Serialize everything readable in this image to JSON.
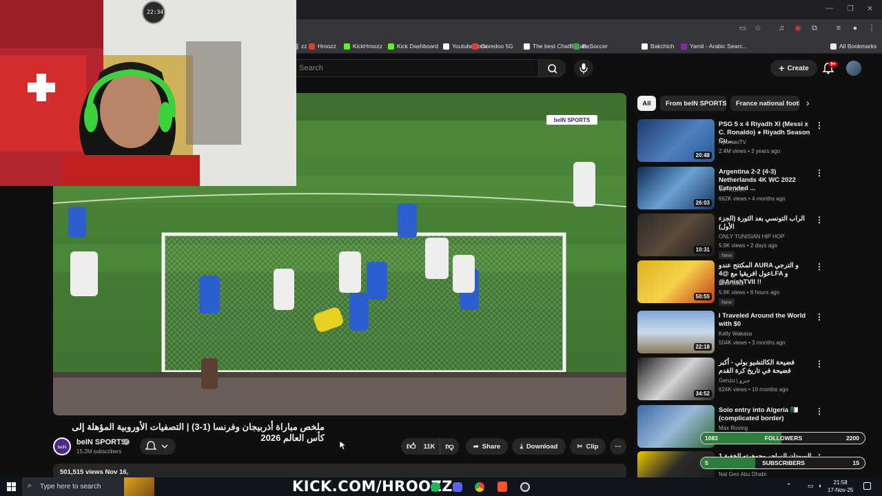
{
  "browser": {
    "bookmarks": [
      {
        "label": "zz",
        "color": "#888"
      },
      {
        "label": "Hroozz",
        "color": "#e53935"
      },
      {
        "label": "KickHroozz",
        "color": "#53fc18"
      },
      {
        "label": "Kick Dashboard",
        "color": "#53fc18"
      },
      {
        "label": "Youtube conv",
        "color": "#ffffff"
      },
      {
        "label": "Ooredoo 5G",
        "color": "#e53935"
      },
      {
        "label": "The best ChatBot an...",
        "color": "#ffffff"
      },
      {
        "label": "BeSoccer",
        "color": "#43a047"
      },
      {
        "label": "Bakchich",
        "color": "#ffffff"
      },
      {
        "label": "Yamli - Arabic Searc...",
        "color": "#8e24aa"
      },
      {
        "label": "All Bookmarks",
        "color": "#e8eaed"
      }
    ]
  },
  "header": {
    "search_placeholder": "Search",
    "create_label": "Create",
    "notifications": "9+"
  },
  "webcam": {
    "clock_text": "22:34"
  },
  "video": {
    "watermark": "beIN SPORTS",
    "title": "ملخص مباراة أذربيجان وفرنسا (1-3) | التصفيات الأوروبية المؤهلة إلى كأس العالم 2026",
    "channel": "beIN SPORTS",
    "subscribers": "15.2M subscribers",
    "likes": "11K",
    "share_label": "Share",
    "download_label": "Download",
    "clip_label": "Clip",
    "views_date": "501,515 views  Nov 16,"
  },
  "chips": [
    "All",
    "From beIN SPORTS",
    "France national footb"
  ],
  "recommendations": [
    {
      "title": "PSG 5 x 4 Riyadh XI (Messi x C. Ronaldo) ● Riyadh Season Cu...",
      "channel": "RptimaoTV",
      "verified": true,
      "meta": "2.4M views • 2 years ago",
      "duration": "20:48",
      "new": false,
      "thumb": "linear-gradient(135deg,#1e3a6b,#4f7fbf 55%,#2a5a9a)"
    },
    {
      "title": "Argentina 2-2 (4-3) Netherlands 4K WC 2022 Extended ...",
      "channel": "VIP KORA",
      "verified": false,
      "meta": "662K views • 4 months ago",
      "duration": "26:03",
      "new": false,
      "thumb": "linear-gradient(135deg,#0d2b52,#6aa0d4 50%,#17375e)"
    },
    {
      "title": "الراب التونسي بعد الثورة (الجزء الأول)",
      "channel": "ONLY TUNISIAN HIP HOP",
      "verified": false,
      "meta": "5.9K views • 2 days ago",
      "duration": "10:31",
      "new": true,
      "thumb": "linear-gradient(135deg,#2b2b2b,#5a4a3a 50%,#1a1a1a)"
    },
    {
      "title": "المكتتح عندو AURA و الترجي عول افريقيا مع @4LFA و @AnishTVII !!",
      "channel": "Dhia Saibi",
      "verified": false,
      "meta": "5.9K views • 8 hours ago",
      "duration": "50:55",
      "new": true,
      "thumb": "linear-gradient(135deg,#e0b020,#f5d24a 50%,#c43a1a)"
    },
    {
      "title": "I Traveled Around the World with $0",
      "channel": "Kelly Wakasa",
      "verified": true,
      "meta": "504K views • 3 months ago",
      "duration": "22:18",
      "new": false,
      "thumb": "linear-gradient(180deg,#7fa8d6,#c9d9ea 50%,#8a7a5a)"
    },
    {
      "title": "فضيحة الكالتشيو بولي - أكبر فضيحة في تاريخ كرة القدم",
      "channel": "Genzu | جنزو",
      "verified": false,
      "meta": "624K views • 10 months ago",
      "duration": "34:52",
      "new": false,
      "thumb": "linear-gradient(135deg,#1a1a1a,#d4d4d4 50%,#2a2a2a)"
    },
    {
      "title": "Solo entry into Algeria 🇩🇿 (complicated border)",
      "channel": "Max Roving",
      "verified": true,
      "meta": "",
      "duration": "",
      "new": false,
      "thumb": "linear-gradient(135deg,#3a6aa8,#9ab8d8 50%,#2d6b3a)"
    },
    {
      "title": "السودان الساحر وجوهرته الخفية 1 ...",
      "channel": "Nat Geo Abu Dhabi",
      "verified": false,
      "meta": "",
      "duration": "",
      "new": false,
      "thumb": "linear-gradient(135deg,#f0c800,#2a2a2a 45%,#1a1a1a)"
    }
  ],
  "overlay": {
    "followers_label": "FOLLOWERS",
    "followers_current": "1083",
    "followers_goal": "2200",
    "followers_fraction": 0.49,
    "subs_label": "SUBSCRIBERS",
    "subs_current": "5",
    "subs_goal": "15",
    "subs_fraction": 0.33,
    "kick_url": "KICK.COM/HROOZZ"
  },
  "taskbar": {
    "search_placeholder": "Type here to search",
    "time": "21:58",
    "date": "17-Nov-25"
  }
}
